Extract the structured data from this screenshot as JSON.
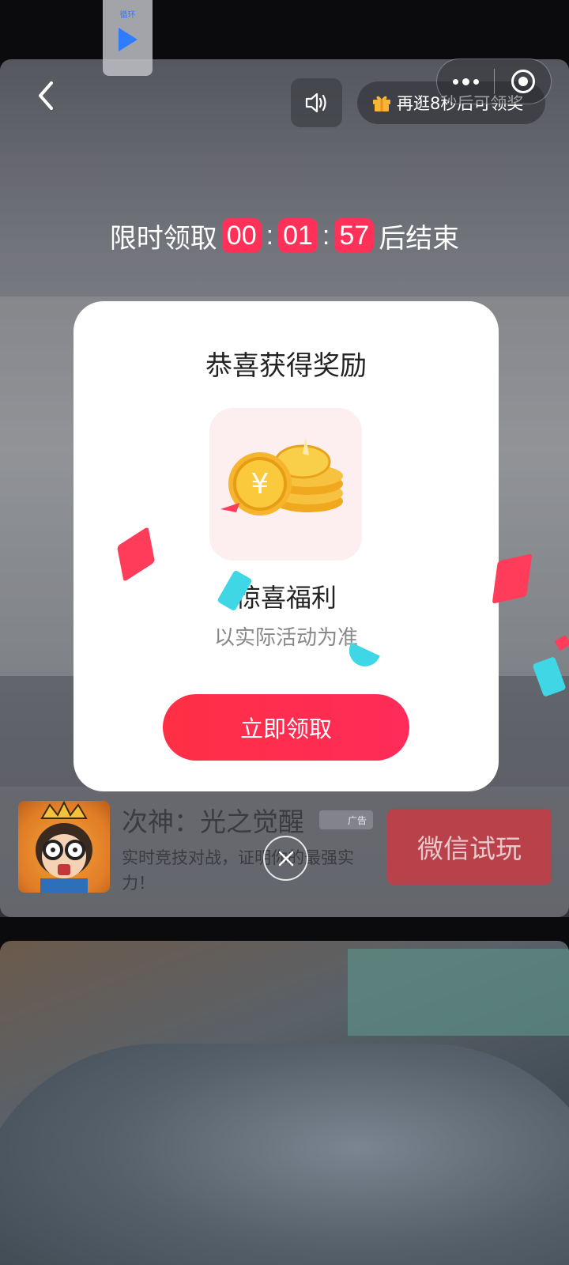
{
  "mini_player": {
    "label": "循环"
  },
  "header": {
    "reward_countdown_text": "再逛8秒后可领奖"
  },
  "timer": {
    "prefix": "限时领取",
    "hours": "00",
    "minutes": "01",
    "seconds": "57",
    "separator": ":",
    "suffix": "后结束"
  },
  "modal": {
    "title": "恭喜获得奖励",
    "prize_name": "惊喜福利",
    "prize_note": "以实际活动为准",
    "claim_button": "立即领取"
  },
  "ad": {
    "title": "次神：光之觉醒",
    "badge": "广告",
    "description": "实时竞技对战，证明你的最强实力！",
    "cta": "微信试玩"
  },
  "colors": {
    "accent_red": "#ff2f45",
    "timer_red": "#ff3158",
    "mini_player_blue": "#2f7cff"
  }
}
